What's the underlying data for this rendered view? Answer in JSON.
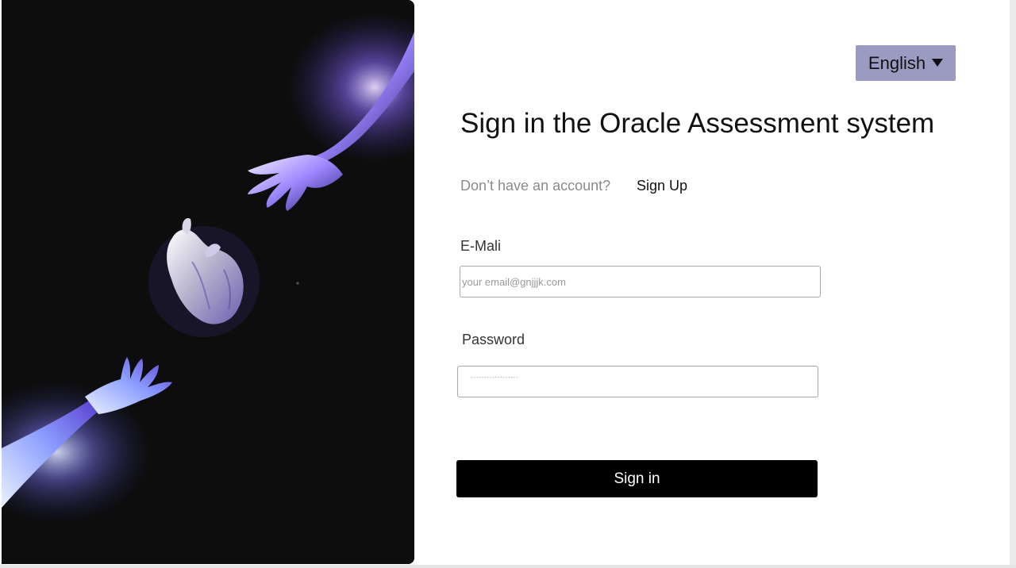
{
  "language": {
    "selected": "English",
    "icon": "caret-down-icon",
    "background": "#9b9bc2"
  },
  "heading": {
    "title": "Sign in the Oracle Assessment system"
  },
  "signup_prompt": {
    "text": "Don’t have an account?",
    "link_label": "Sign Up"
  },
  "email": {
    "label": "E-Mali",
    "placeholder": "your email@gnjjjk.com",
    "value": ""
  },
  "password": {
    "label": "Password",
    "placeholder": "··················",
    "value": ""
  },
  "signin": {
    "label": "Sign in",
    "background": "#000000"
  },
  "hero": {
    "description_icons": [
      "reaching-hand-icon",
      "anatomical-heart-icon",
      "reaching-hand-icon"
    ],
    "accent": "#8a6bff"
  }
}
